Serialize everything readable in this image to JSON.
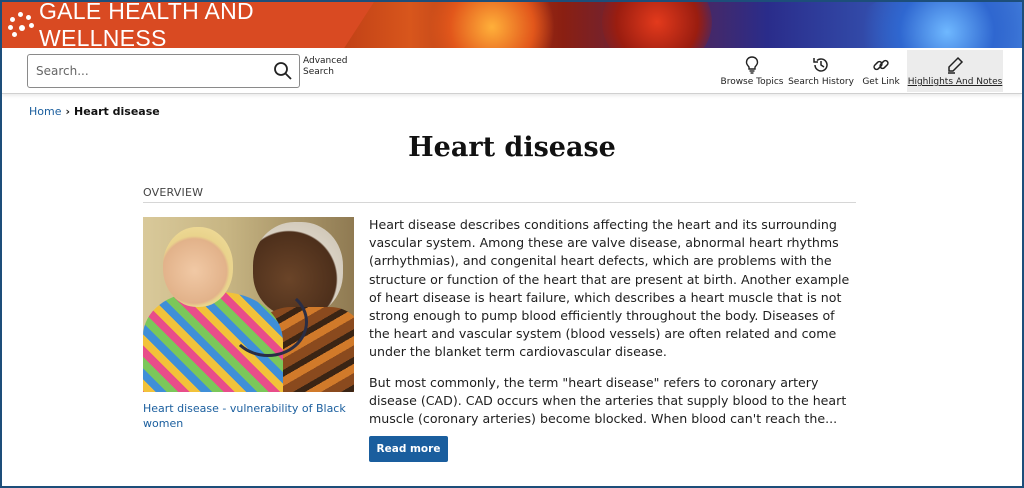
{
  "brand": {
    "title": "GALE HEALTH AND WELLNESS"
  },
  "search": {
    "placeholder": "Search...",
    "advanced_line1": "Advanced",
    "advanced_line2": "Search"
  },
  "toolbar": {
    "browse_topics": "Browse Topics",
    "search_history": "Search History",
    "get_link": "Get Link",
    "highlights_notes": "Highlights And Notes"
  },
  "breadcrumb": {
    "home": "Home",
    "current": "Heart disease"
  },
  "page": {
    "title": "Heart disease",
    "section_label": "OVERVIEW"
  },
  "image": {
    "caption": "Heart disease - vulnerability of Black women"
  },
  "article": {
    "paragraph1": "Heart disease describes conditions affecting the heart and its surrounding vascular system. Among these are valve disease, abnormal heart rhythms (arrhythmias), and congenital heart defects, which are problems with the structure or function of the heart that are present at birth. Another example of heart disease is heart failure, which describes a heart muscle that is not strong enough to pump blood efficiently throughout the body. Diseases of the heart and vascular system (blood vessels) are often related and come under the blanket term cardiovascular disease.",
    "paragraph2": "But most commonly, the term \"heart disease\" refers to coronary artery disease (CAD). CAD occurs when the arteries that supply blood to the heart muscle (coronary arteries) become blocked. When blood can't reach the...",
    "read_more": "Read more"
  },
  "colors": {
    "brand_orange": "#d94a22",
    "link_blue": "#1a5e9e",
    "frame_border": "#1d4e7a"
  }
}
